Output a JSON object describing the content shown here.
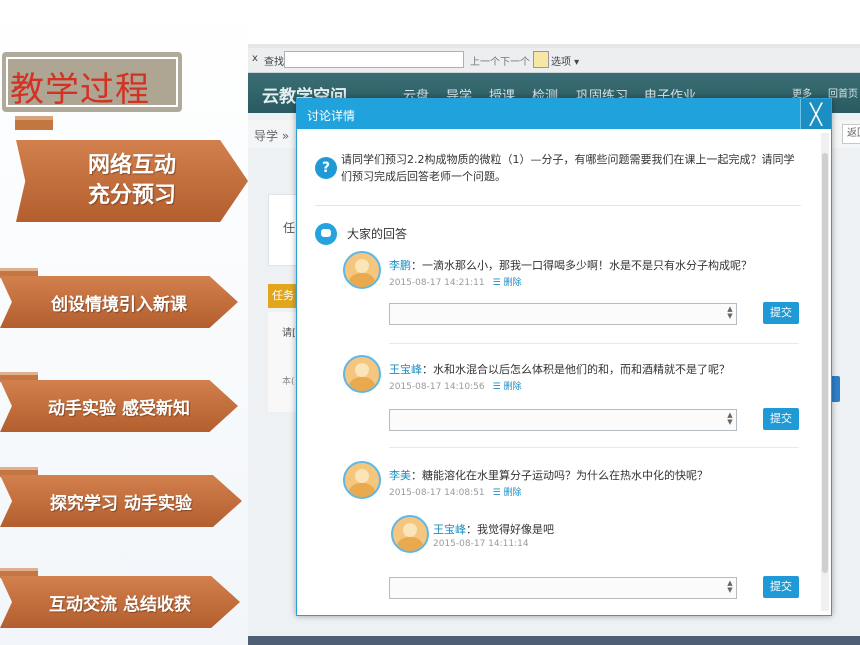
{
  "slide": {
    "title": "教学过程",
    "steps": [
      "网络互动\n充分预习",
      "创设情境引入新课",
      "动手实验 感受新知",
      "探究学习 动手实验",
      "互动交流 总结收获"
    ]
  },
  "findbar": {
    "close": "x",
    "label": "查找:",
    "prev": "上一个",
    "next": "下一个",
    "options": "选项 ▾"
  },
  "app": {
    "logo": "云教学空间",
    "nav": [
      "云盘",
      "导学",
      "授课",
      "检测",
      "巩固练习",
      "电子作业"
    ],
    "more": "更多",
    "home": "回首页",
    "breadcrumb": "导学 »",
    "back": "返回",
    "bg_card_text": "任",
    "bg_tag": "任务",
    "bg_snippet1": "请[",
    "bg_snippet2": "本("
  },
  "dialog": {
    "title": "讨论详情",
    "close_icon": "close-icon",
    "question": "请同学们预习2.2构成物质的微粒（1）—分子，有哪些问题需要我们在课上一起完成？请同学们预习完成后回答老师一个问题。",
    "answers_label": "大家的回答",
    "delete_label": "删除",
    "submit_label": "提交",
    "answers": [
      {
        "name": "李鹏",
        "text": "：一滴水那么小，那我一口得喝多少啊！水是不是只有水分子构成呢？",
        "time": "2015-08-17 14:21:11"
      },
      {
        "name": "王宝峰",
        "text": "：水和水混合以后怎么体积是他们的和，而和酒精就不是了呢？",
        "time": "2015-08-17 14:10:56"
      },
      {
        "name": "李美",
        "text": "：糖能溶化在水里算分子运动吗？为什么在热水中化的快呢？",
        "time": "2015-08-17 14:08:51"
      }
    ],
    "nested_reply": {
      "name": "王宝峰",
      "text": "：我觉得好像是吧",
      "time": "2015-08-17 14:11:14"
    }
  }
}
